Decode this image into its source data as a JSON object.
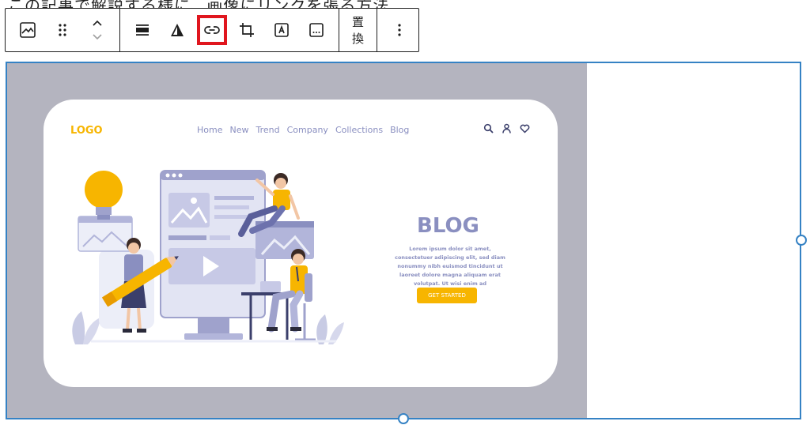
{
  "background_text": "この記事で解説する様に、画像にリンクを張る方法",
  "toolbar": {
    "replace_label": "置換",
    "highlighted_button": "link"
  },
  "image": {
    "logo": "LOGO",
    "nav": [
      "Home",
      "New",
      "Trend",
      "Company",
      "Collections",
      "Blog"
    ],
    "blog_title": "BLOG",
    "blog_desc": "Lorem ipsum dolor sit amet, consectetuer adipiscing elit, sed diam nonummy nibh euismod tincidunt ut laoreet dolore magna aliquam erat volutpat. Ut wisi enim ad",
    "cta": "GET STARTED"
  },
  "colors": {
    "accent": "#3582c4",
    "highlight": "#e0161e",
    "image_bg": "#b4b4bf",
    "brand_yellow": "#f7b500",
    "brand_purple": "#8a8fc0"
  }
}
